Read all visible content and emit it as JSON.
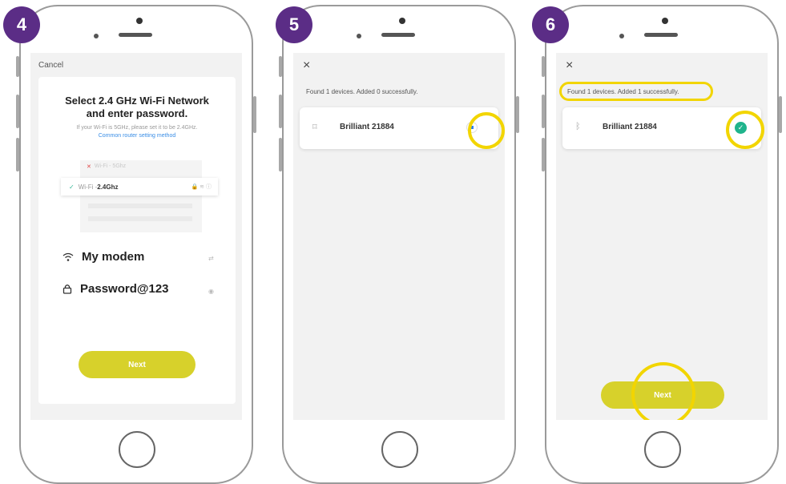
{
  "steps": [
    {
      "badge": "4",
      "cancel_label": "Cancel",
      "title": "Select 2.4 GHz Wi-Fi Network and enter password.",
      "hint": "If your Wi-Fi is 5GHz, please set it to be 2.4GHz.",
      "help_link": "Common router setting method",
      "illustration": {
        "bad_network": "Wi-Fi - 5Ghz",
        "good_network_prefix": "Wi-Fi - ",
        "good_network_band": "2.4Ghz"
      },
      "ssid": "My modem",
      "password": "Password@123",
      "next_label": "Next"
    },
    {
      "badge": "5",
      "close_label": "×",
      "found_text": "Found 1 devices. Added 0 successfully.",
      "device_name": "Brilliant 21884"
    },
    {
      "badge": "6",
      "close_label": "×",
      "found_text": "Found 1 devices. Added 1 successfully.",
      "device_name": "Brilliant 21884",
      "next_label": "Next"
    }
  ],
  "colors": {
    "badge": "#5b2d86",
    "highlight": "#f2d500",
    "button": "#d7d12b",
    "success": "#1fb48c",
    "link": "#3a8ee6",
    "progress": "#2a7ef0"
  }
}
